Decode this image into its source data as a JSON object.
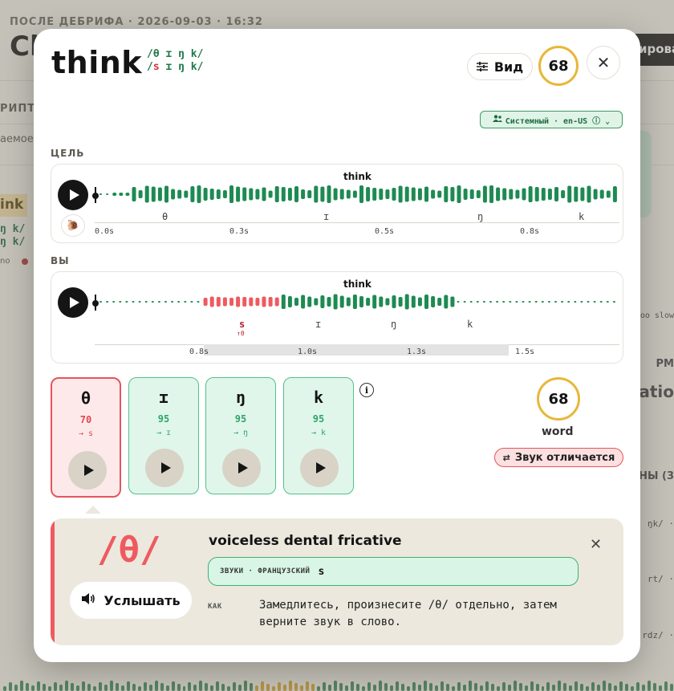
{
  "background": {
    "header": "ПОСЛЕ ДЕБРИФА · 2026-09-03 · 16:32",
    "title": "Cl",
    "right_button": "ировать",
    "script_label": "РИПТ",
    "muted_label": "аемое",
    "word_chip": "ink",
    "ipa_a": "ŋ k/",
    "ipa_b": "ŋ k/",
    "line_c": "no",
    "right_slow": "oo slow",
    "right_pm": "PM",
    "right_ntatio": "ntatio",
    "right_ny": "НЫ (3",
    "right_r1": "ŋk/ ·",
    "right_r2": "rt/ ·",
    "right_r3": "rdz/ ·"
  },
  "modal": {
    "word": "think",
    "ipa_target": "/θ ɪ ŋ k/",
    "ipa_user_bad": "s",
    "ipa_user_prefix": "/",
    "ipa_user_rest": " ɪ ŋ k/",
    "view_label": "Вид",
    "score": "68",
    "close_icon": "✕",
    "voice_pill": "Системный · en-US ⓘ ⌄",
    "target": {
      "section_label": "ЦЕЛЬ",
      "word": "think",
      "phonemes": [
        "θ",
        "ɪ",
        "ŋ",
        "k"
      ],
      "ticks": [
        "0.0s",
        "0.3s",
        "0.5s",
        "0.8s"
      ]
    },
    "user": {
      "section_label": "ВЫ",
      "word": "think",
      "phonemes": [
        "s",
        "ɪ",
        "ŋ",
        "k"
      ],
      "substitution_note": "↑θ",
      "ticks": [
        "0.8s",
        "1.0s",
        "1.3s",
        "1.5s"
      ]
    },
    "phoneme_cards": [
      {
        "symbol": "θ",
        "score": "70",
        "heard": "→ s",
        "status": "bad"
      },
      {
        "symbol": "ɪ",
        "score": "95",
        "heard": "→ ɪ",
        "status": "good"
      },
      {
        "symbol": "ŋ",
        "score": "95",
        "heard": "→ ŋ",
        "status": "good"
      },
      {
        "symbol": "k",
        "score": "95",
        "heard": "→ k",
        "status": "good"
      }
    ],
    "word_score": "68",
    "word_label": "word",
    "diff_label": "Звук отличается",
    "detail": {
      "ipa": "/θ/",
      "hear_label": "Услышать",
      "name": "voiceless dental fricative",
      "sounds_key": "ЗВУКИ · ФРАНЦУЗСКИЙ",
      "sounds_value": "s",
      "how_key": "КАК",
      "how_value": "Замедлитесь, произнесите /θ/ отдельно, затем верните звук в слово."
    }
  },
  "colors": {
    "good": "#2fa56b",
    "bad": "#e0474f",
    "score_ring": "#e8b73a",
    "wave_green": "#1e8a52",
    "wave_red": "#ef5a60"
  }
}
